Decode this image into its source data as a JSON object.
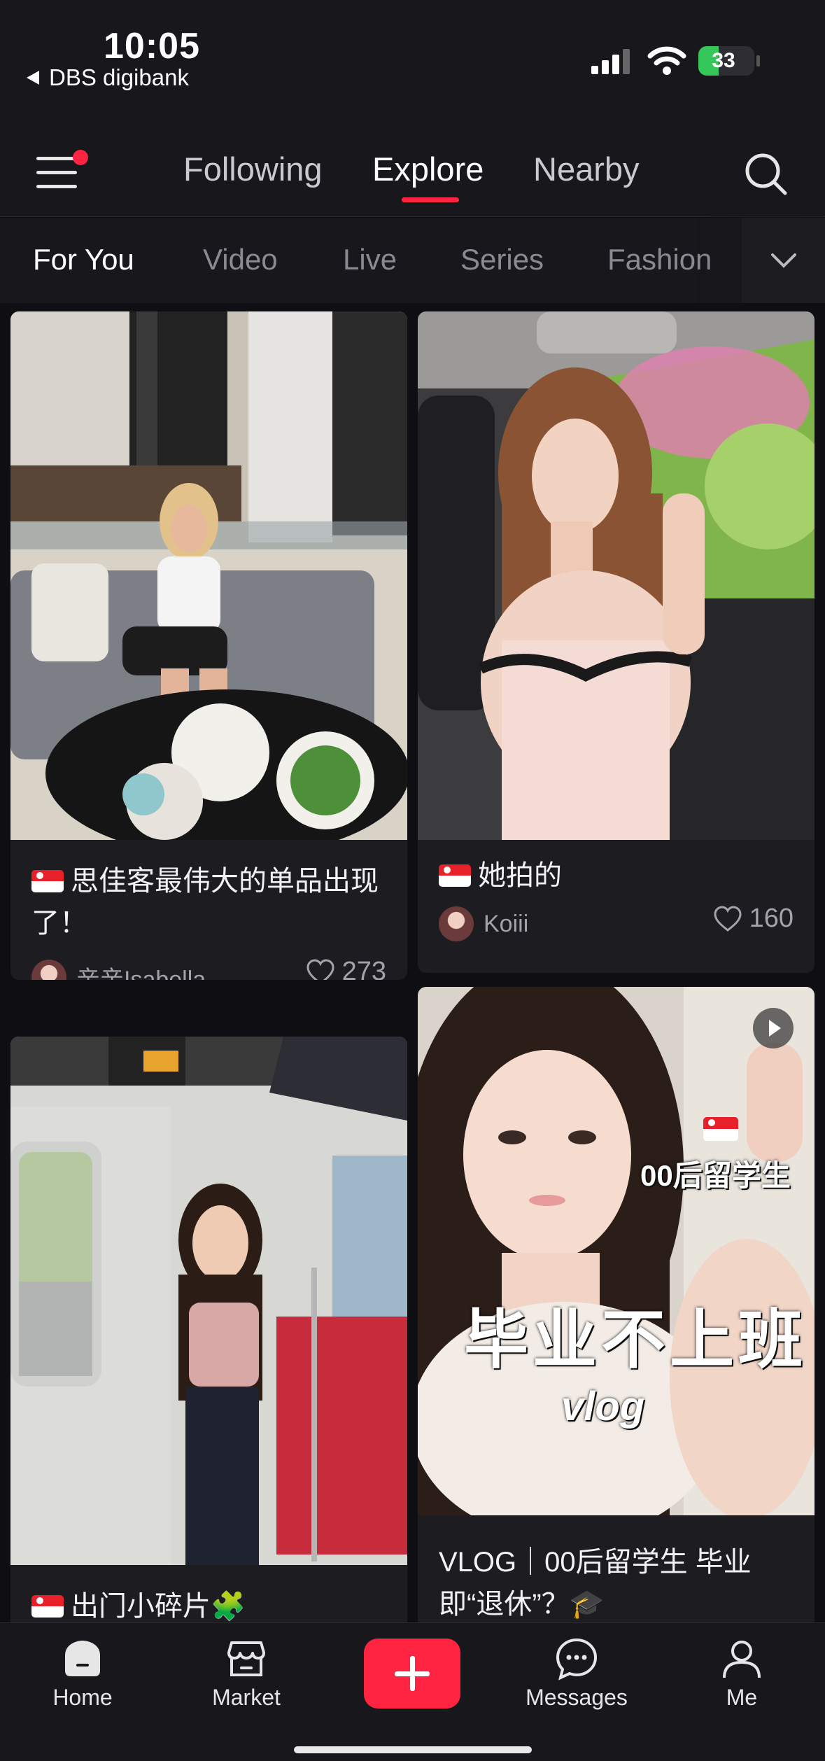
{
  "status_bar": {
    "time": "10:05",
    "back_app": "DBS digibank",
    "battery": "33"
  },
  "top_nav": {
    "tabs": [
      {
        "label": "Following"
      },
      {
        "label": "Explore",
        "active": true
      },
      {
        "label": "Nearby"
      }
    ],
    "icons": [
      "menu-icon",
      "search-icon"
    ],
    "accent_color": "#ff2442"
  },
  "categories": {
    "items": [
      "For You",
      "Video",
      "Live",
      "Series",
      "Fashion"
    ],
    "active": "For You"
  },
  "feed": {
    "cards": [
      {
        "title": "思佳客最伟大的单品出现了！",
        "author": "亲亲Isabella",
        "likes": "273"
      },
      {
        "title": "她拍的",
        "author": "Koiii",
        "likes": "160"
      },
      {
        "title": "出门小碎片🧩"
      },
      {
        "title": "VLOG｜00后留学生 毕业即“退休”？🎓",
        "overlay_line1": "00后留学生",
        "overlay_line2": "毕业不上班",
        "overlay_line3": "vlog"
      }
    ]
  },
  "bottom_nav": {
    "items": [
      {
        "label": "Home",
        "icon": "home-icon"
      },
      {
        "label": "Market",
        "icon": "shop-icon"
      },
      {
        "label": "",
        "icon": "add-icon"
      },
      {
        "label": "Messages",
        "icon": "chat-icon"
      },
      {
        "label": "Me",
        "icon": "user-icon"
      }
    ]
  }
}
